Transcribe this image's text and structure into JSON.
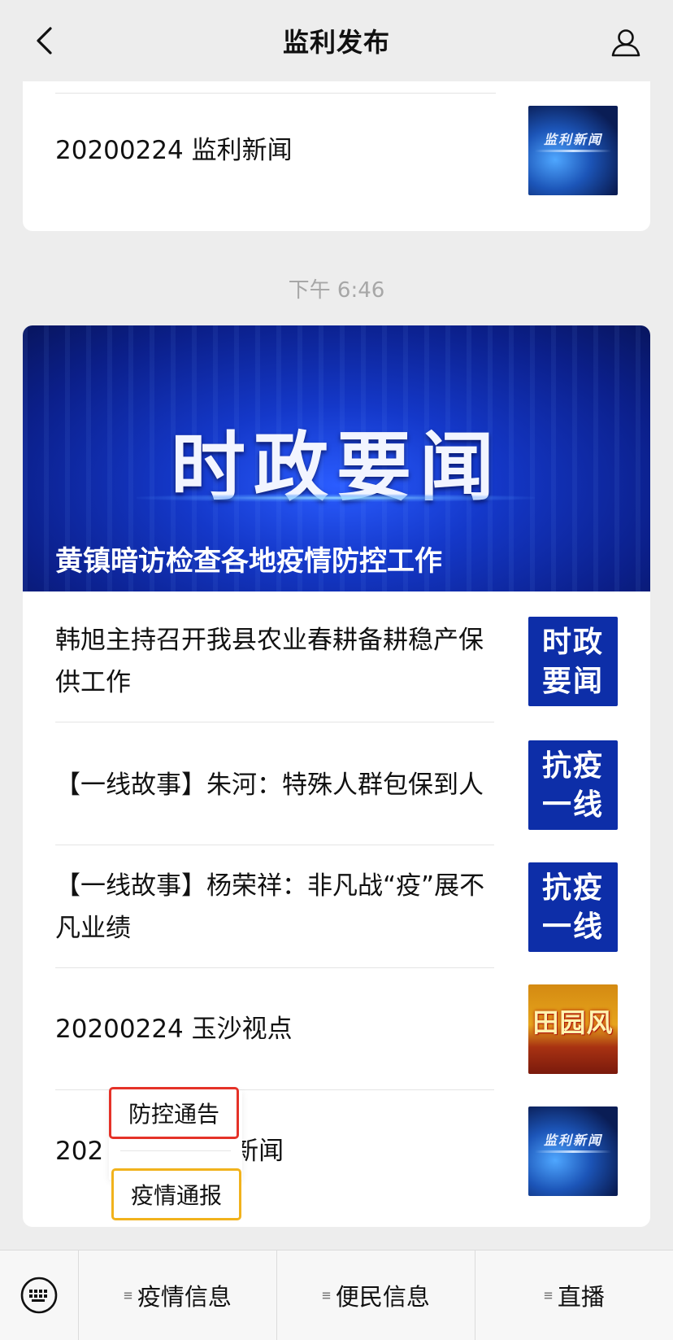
{
  "header": {
    "title": "监利发布"
  },
  "card1": {
    "article": {
      "title": "20200224 监利新闻",
      "thumb_icon": "news-thumbnail-icon",
      "thumb_label": "监利新闻"
    }
  },
  "timestamp": "下午 6:46",
  "card2": {
    "banner": {
      "main_title": "时政要闻",
      "caption": "黄镇暗访检查各地疫情防控工作"
    },
    "articles": [
      {
        "title": "韩旭主持召开我县农业春耕备耕稳产保供工作",
        "thumb_line1": "时政",
        "thumb_line2": "要闻"
      },
      {
        "title": "【一线故事】朱河：特殊人群包保到人",
        "thumb_line1": "抗疫",
        "thumb_line2": "一线"
      },
      {
        "title": "【一线故事】杨荣祥：非凡战“疫”展不凡业绩",
        "thumb_line1": "抗疫",
        "thumb_line2": "一线"
      },
      {
        "title": "20200224 玉沙视点",
        "thumb_label": "田园风"
      },
      {
        "title_start": "202",
        "title_end": "新闻",
        "thumb_label": "监利新闻"
      }
    ]
  },
  "popup": {
    "items": [
      "防控通告",
      "疫情通报"
    ]
  },
  "bottom_menu": {
    "items": [
      "疫情信息",
      "便民信息",
      "直播"
    ]
  },
  "colors": {
    "background": "#ededed",
    "popup_highlight_red": "#e53228",
    "popup_highlight_yellow": "#f1b21c",
    "banner_blue": "#1438c9"
  }
}
